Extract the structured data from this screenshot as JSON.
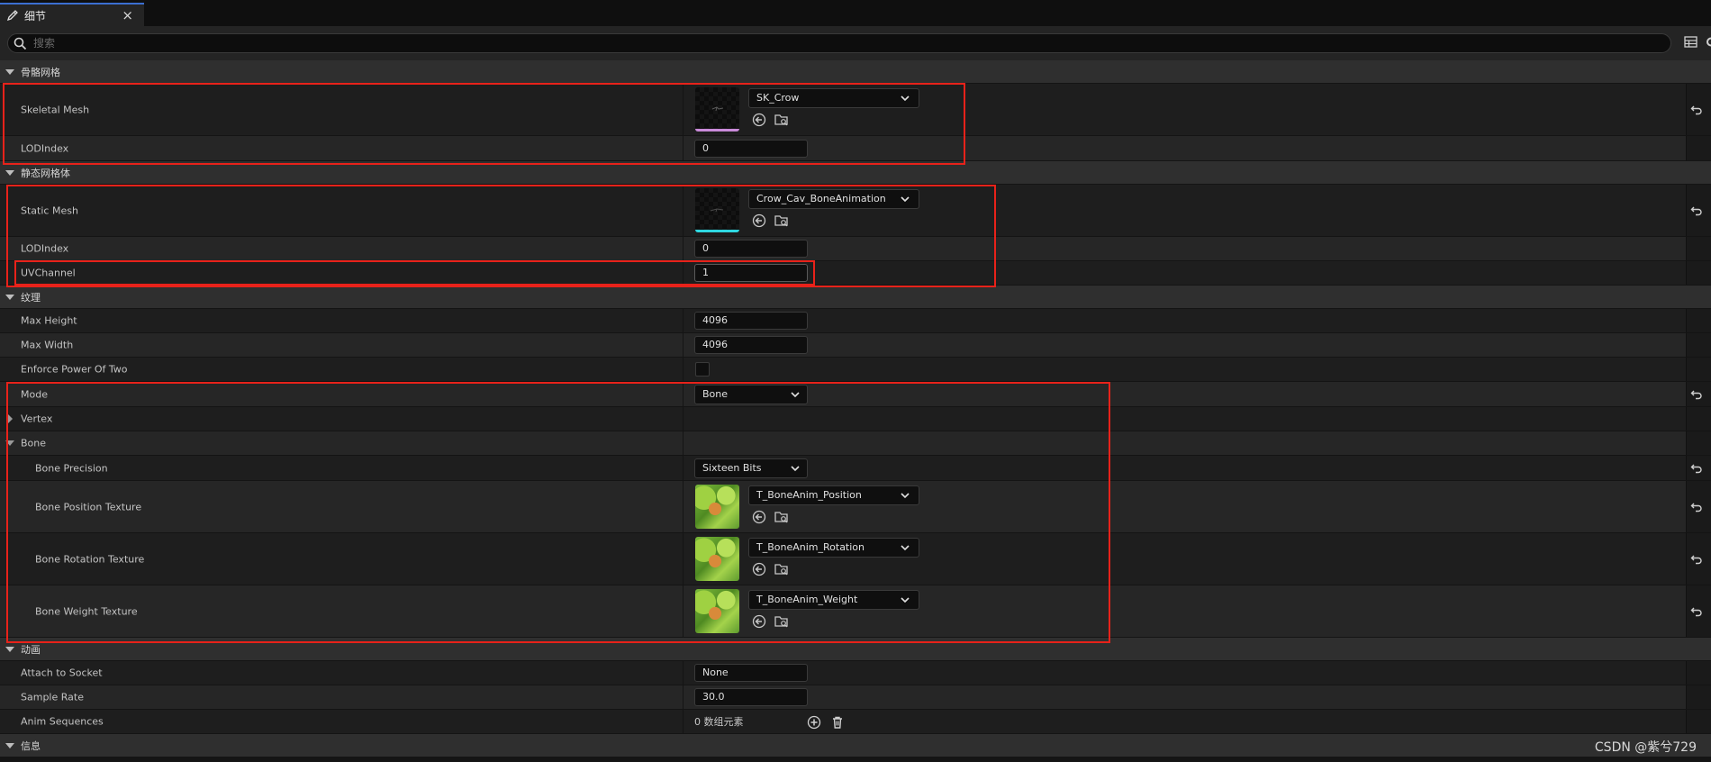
{
  "tab": {
    "title": "细节",
    "close": "×",
    "icon": "pencil-icon"
  },
  "search": {
    "placeholder": "搜索"
  },
  "sections": {
    "skeletal": "骨骼网格",
    "static": "静态网格体",
    "texture": "纹理",
    "animation": "动画",
    "info": "信息"
  },
  "skeletal": {
    "mesh_label": "Skeletal Mesh",
    "mesh_value": "SK_Crow",
    "lod_label": "LODIndex",
    "lod_value": "0"
  },
  "static": {
    "mesh_label": "Static Mesh",
    "mesh_value": "Crow_Cav_BoneAnimation",
    "lod_label": "LODIndex",
    "lod_value": "0",
    "uv_label": "UVChannel",
    "uv_value": "1"
  },
  "texture": {
    "max_height_label": "Max Height",
    "max_height_value": "4096",
    "max_width_label": "Max Width",
    "max_width_value": "4096",
    "enforce_label": "Enforce Power Of Two",
    "enforce_checked": false,
    "mode_label": "Mode",
    "mode_value": "Bone",
    "vertex_label": "Vertex",
    "bone_label": "Bone",
    "bone_precision_label": "Bone Precision",
    "bone_precision_value": "Sixteen Bits",
    "bone_position_label": "Bone Position Texture",
    "bone_position_value": "T_BoneAnim_Position",
    "bone_rotation_label": "Bone Rotation Texture",
    "bone_rotation_value": "T_BoneAnim_Rotation",
    "bone_weight_label": "Bone Weight Texture",
    "bone_weight_value": "T_BoneAnim_Weight"
  },
  "animation": {
    "attach_label": "Attach to Socket",
    "attach_value": "None",
    "sample_rate_label": "Sample Rate",
    "sample_rate_value": "30.0",
    "anim_seq_label": "Anim Sequences",
    "anim_seq_value": "0 数组元素"
  },
  "colors": {
    "highlight": "#e8221a",
    "skeletal_underline": "#c98ad9",
    "static_underline": "#2fd7e0",
    "tab_accent": "#3b6fd1"
  },
  "watermark": "CSDN @紫兮729"
}
